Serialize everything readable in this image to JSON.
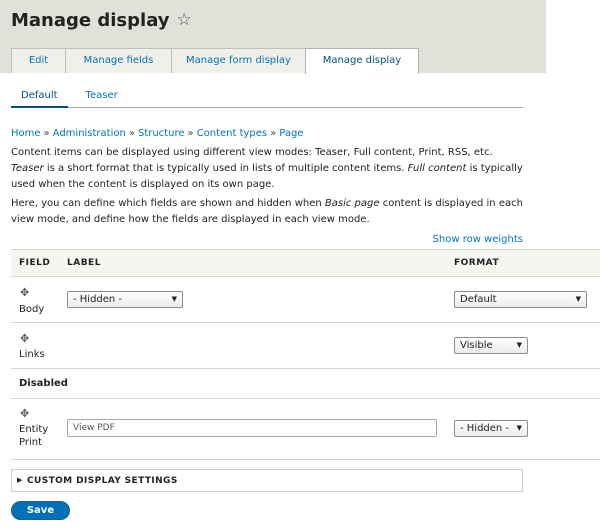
{
  "page": {
    "title": "Manage display"
  },
  "tabs": [
    "Edit",
    "Manage fields",
    "Manage form display",
    "Manage display"
  ],
  "subtabs": [
    "Default",
    "Teaser"
  ],
  "breadcrumb": [
    "Home",
    "Administration",
    "Structure",
    "Content types",
    "Page"
  ],
  "breadcrumb_separator": "»",
  "description": {
    "p1_a": "Content items can be displayed using different view modes: Teaser, Full content, Print, RSS, etc. ",
    "p1_em1": "Teaser",
    "p1_b": " is a short format that is typically used in lists of multiple content items. ",
    "p1_em2": "Full content",
    "p1_c": " is typically used when the content is displayed on its own page.",
    "p2_a": "Here, you can define which fields are shown and hidden when ",
    "p2_em": "Basic page",
    "p2_b": " content is displayed in each view mode, and define how the fields are displayed in each view mode."
  },
  "show_row_weights": "Show row weights",
  "table": {
    "headers": {
      "field": "FIELD",
      "label": "LABEL",
      "format": "FORMAT"
    },
    "rows": [
      {
        "field": "Body",
        "label_select": "- Hidden -",
        "format_select": "Default"
      },
      {
        "field": "Links",
        "format_select": "Visible"
      }
    ],
    "disabled_region": "Disabled",
    "disabled_rows": [
      {
        "field_line1": "Entity",
        "field_line2": "Print",
        "label_value": "View PDF",
        "format_select": "- Hidden -"
      }
    ]
  },
  "custom_display_settings": "CUSTOM DISPLAY SETTINGS",
  "save_label": "Save",
  "icons": {
    "favorite": "star-outline-icon",
    "drag": "drag-handle-icon",
    "dropdown": "chevron-down-icon",
    "details": "triangle-right-icon"
  },
  "colors": {
    "link": "#0074bd",
    "header_bg": "#e1e0d9",
    "primary_button": "#0071b8"
  }
}
